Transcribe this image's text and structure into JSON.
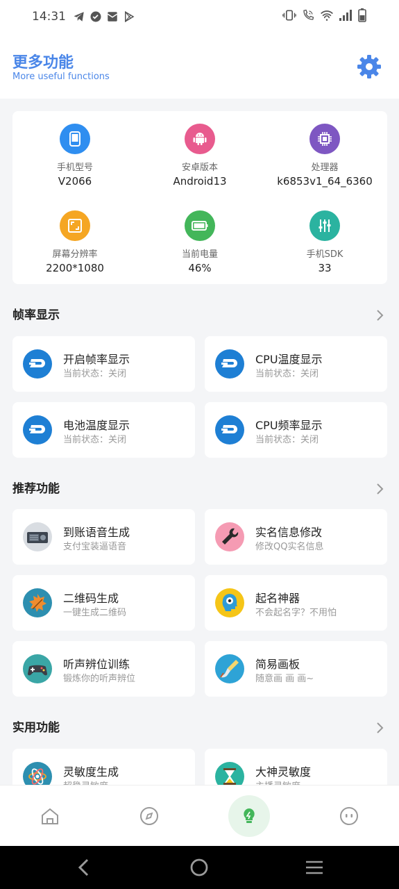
{
  "status_bar": {
    "time": "14:31",
    "left_icons": [
      "telegram-icon",
      "check-circle-icon",
      "mail-icon",
      "play-store-icon"
    ],
    "right_icons": [
      "vibrate-icon",
      "wifi-call-icon",
      "wifi-icon",
      "signal-icon",
      "battery-icon"
    ]
  },
  "header": {
    "title": "更多功能",
    "subtitle": "More useful functions",
    "accent_color": "#4a86e8"
  },
  "device_info": [
    {
      "label": "手机型号",
      "value": "V2066",
      "color": "#2f8ef0",
      "icon": "phone-icon"
    },
    {
      "label": "安卓版本",
      "value": "Android13",
      "color": "#e85b8e",
      "icon": "android-icon"
    },
    {
      "label": "处理器",
      "value": "k6853v1_64_6360",
      "color": "#7e57c2",
      "icon": "chip-icon"
    },
    {
      "label": "屏幕分辨率",
      "value": "2200*1080",
      "color": "#f5a623",
      "icon": "screen-icon"
    },
    {
      "label": "当前电量",
      "value": "46%",
      "color": "#43b65a",
      "icon": "battery-icon"
    },
    {
      "label": "手机SDK",
      "value": "33",
      "color": "#2bb3a0",
      "icon": "sliders-icon"
    }
  ],
  "sections": {
    "fps": {
      "title": "帧率显示",
      "items": [
        {
          "title": "开启帧率显示",
          "sub": "当前状态：关闭"
        },
        {
          "title": "CPU温度显示",
          "sub": "当前状态：关闭"
        },
        {
          "title": "电池温度显示",
          "sub": "当前状态：关闭"
        },
        {
          "title": "CPU频率显示",
          "sub": "当前状态：关闭"
        }
      ]
    },
    "recommend": {
      "title": "推荐功能",
      "items": [
        {
          "title": "到账语音生成",
          "sub": "支付宝装逼语音",
          "icon": "radio-icon"
        },
        {
          "title": "实名信息修改",
          "sub": "修改QQ实名信息",
          "icon": "wrench-icon"
        },
        {
          "title": "二维码生成",
          "sub": "一键生成二维码",
          "icon": "leaf-icon"
        },
        {
          "title": "起名神器",
          "sub": "不会起名字？不用怕",
          "icon": "brain-icon"
        },
        {
          "title": "听声辨位训练",
          "sub": "锻炼你的听声辨位",
          "icon": "gamepad-icon"
        },
        {
          "title": "简易画板",
          "sub": "随意画 画 画~",
          "icon": "brush-icon"
        }
      ]
    },
    "practical": {
      "title": "实用功能",
      "items": [
        {
          "title": "灵敏度生成",
          "sub": "超稳灵敏度",
          "icon": "atom-icon"
        },
        {
          "title": "大神灵敏度",
          "sub": "主播灵敏度",
          "icon": "hourglass-icon"
        }
      ]
    }
  },
  "bottom_nav": {
    "items": [
      "home-icon",
      "compass-icon",
      "bulb-icon",
      "robot-icon"
    ],
    "active_color": "#43b65a"
  },
  "system_nav": [
    "back-icon",
    "home-circle-icon",
    "recents-icon"
  ]
}
